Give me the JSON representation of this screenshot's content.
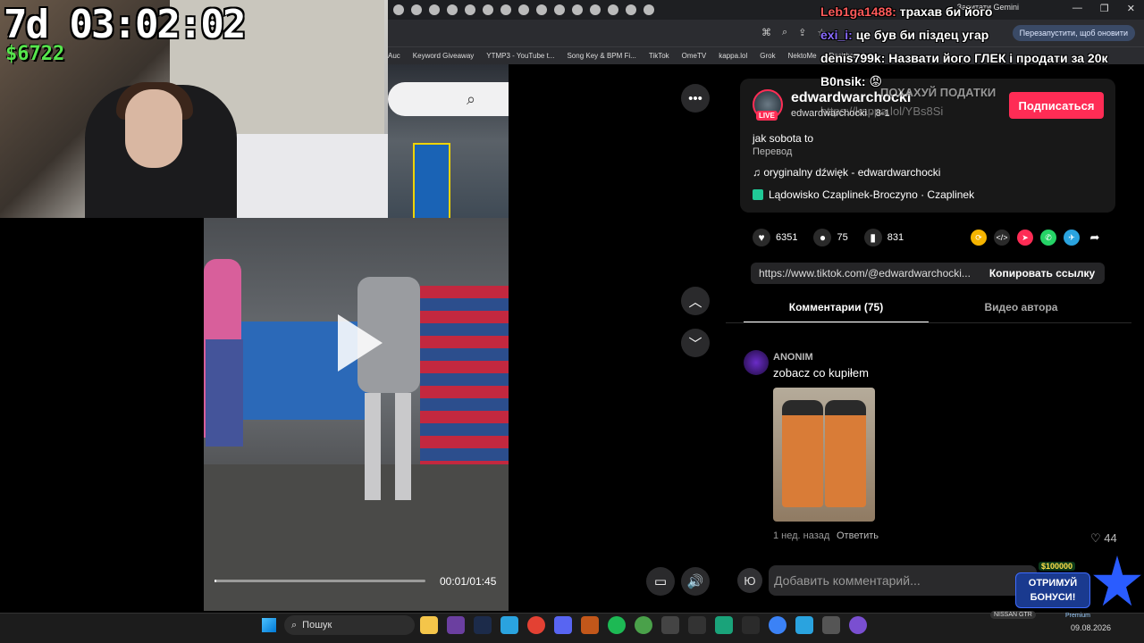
{
  "overlay": {
    "timer": "7d 03:02:02",
    "money": "$6722",
    "chat": [
      {
        "name": "Leb1ga1488:",
        "text": "трахав би його"
      },
      {
        "name": "exi_i:",
        "text": "це був би піздец угар"
      },
      {
        "name": "denis799k:",
        "text": "Назвати його ГЛЕК і продати за 20к"
      },
      {
        "name": "B0nsik:",
        "text": "😡"
      }
    ],
    "ghost_line1": "ПОХАХУЙ ПОДАТКИ",
    "ghost_line2": "https://kappa.lol/YBs8Si"
  },
  "browser": {
    "gemini_label": "Запитати Gemini",
    "restart_label": "Перезапустити, щоб оновити",
    "bookmarks": [
      "Auc",
      "Keyword Giveaway",
      "YTMP3 - YouTube t...",
      "Song Key & BPM Fi...",
      "TikTok",
      "OmeTV",
      "kappa.lol",
      "Grok",
      "NektoMe",
      "Dashboard"
    ]
  },
  "video": {
    "time": "00:01/01:45",
    "progress_fraction": 0.01
  },
  "post": {
    "username": "edwardwarchocki",
    "handle": "edwardwarchocki · 8-1",
    "live_badge": "LIVE",
    "follow_label": "Подписаться",
    "description": "jak sobota to",
    "translate_label": "Перевод",
    "sound": "♫  oryginalny dźwięk - edwardwarchocki",
    "location": "Lądowisko Czaplinek-Broczyno · Czaplinek",
    "likes": "6351",
    "comments": "75",
    "saves": "831",
    "url": "https://www.tiktok.com/@edwardwarchocki...",
    "copy_label": "Копировать ссылку"
  },
  "tabs": {
    "comments": "Комментарии (75)",
    "videos": "Видео автора"
  },
  "comment": {
    "user": "ANONIM",
    "text": "zobacz co kupiłem",
    "meta": "1 нед. назад",
    "reply": "Ответить",
    "likes": "♡ 44"
  },
  "composer": {
    "avatar_letter": "Ю",
    "placeholder": "Добавить комментарий..."
  },
  "promo": {
    "amount": "$100000",
    "line1": "ОТРИМУЙ",
    "line2": "БОНУСИ!",
    "nissan": "NISSAN GTR"
  },
  "taskbar": {
    "search_label": "Пошук",
    "premium_label": "Premium",
    "date": "09.08.2026"
  },
  "colors": {
    "accent": "#fe2c55",
    "money": "#56e64c"
  }
}
